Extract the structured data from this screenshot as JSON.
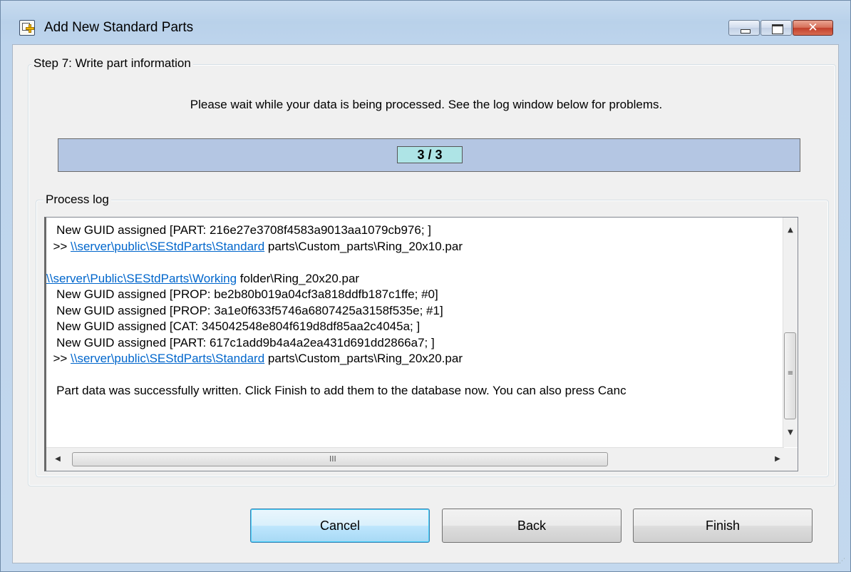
{
  "window": {
    "title": "Add New Standard Parts",
    "controls": {
      "minimize": "minimize",
      "maximize": "maximize",
      "close": "✕"
    }
  },
  "step": {
    "label": "Step 7: Write part information",
    "message": "Please wait while your data is being processed. See the log window below for problems."
  },
  "progress": {
    "text": "3 / 3",
    "current": 3,
    "total": 3
  },
  "log": {
    "label": "Process log",
    "lines": [
      {
        "pre": "   New GUID assigned [PART: 216e27e3708f4583a9013aa1079cb976; ]",
        "link": "",
        "post": ""
      },
      {
        "pre": "  >> ",
        "link": "\\\\server\\public\\SEStdParts\\Standard",
        "post": " parts\\Custom_parts\\Ring_20x10.par"
      },
      {
        "pre": "",
        "link": "",
        "post": ""
      },
      {
        "pre": "",
        "link": "\\\\server\\Public\\SEStdParts\\Working",
        "post": " folder\\Ring_20x20.par"
      },
      {
        "pre": "   New GUID assigned [PROP: be2b80b019a04cf3a818ddfb187c1ffe; #0]",
        "link": "",
        "post": ""
      },
      {
        "pre": "   New GUID assigned [PROP: 3a1e0f633f5746a6807425a3158f535e; #1]",
        "link": "",
        "post": ""
      },
      {
        "pre": "   New GUID assigned [CAT: 345042548e804f619d8df85aa2c4045a; ]",
        "link": "",
        "post": ""
      },
      {
        "pre": "   New GUID assigned [PART: 617c1add9b4a4a2ea431d691dd2866a7; ]",
        "link": "",
        "post": ""
      },
      {
        "pre": "  >> ",
        "link": "\\\\server\\public\\SEStdParts\\Standard",
        "post": " parts\\Custom_parts\\Ring_20x20.par"
      },
      {
        "pre": "",
        "link": "",
        "post": ""
      },
      {
        "pre": "   Part data was successfully written. Click Finish to add them to the database now. You can also press Canc",
        "link": "",
        "post": ""
      }
    ],
    "scroll_glyphs": {
      "up": "▲",
      "down": "▼",
      "left": "◀",
      "right": "▶",
      "v_grip": "≡",
      "h_grip": "III"
    }
  },
  "buttons": {
    "cancel": "Cancel",
    "back": "Back",
    "finish": "Finish"
  },
  "colors": {
    "accent": "#0066cc",
    "progress_bg": "#b4c6e3",
    "progress_label_bg": "#aee4e6",
    "default_button_border": "#3c7fb1"
  }
}
